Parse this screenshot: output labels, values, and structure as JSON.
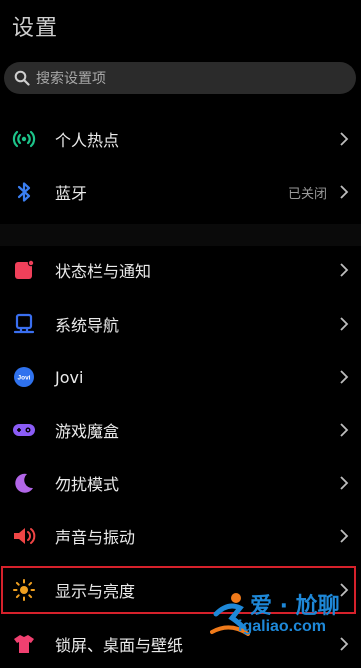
{
  "header": {
    "title": "设置"
  },
  "search": {
    "placeholder": "搜索设置项"
  },
  "items": [
    {
      "label": "个人热点",
      "status": "",
      "icon": "hotspot-icon",
      "color": "#1dc48a"
    },
    {
      "label": "蓝牙",
      "status": "已关闭",
      "icon": "bluetooth-icon",
      "color": "#3a7ef0"
    },
    {
      "label": "状态栏与通知",
      "status": "",
      "icon": "notification-icon",
      "color": "#f0405a"
    },
    {
      "label": "系统导航",
      "status": "",
      "icon": "navigation-icon",
      "color": "#3a6ff0"
    },
    {
      "label": "Jovi",
      "status": "",
      "icon": "jovi-icon",
      "color": "#2f72ee"
    },
    {
      "label": "游戏魔盒",
      "status": "",
      "icon": "gamepad-icon",
      "color": "#8b5cf6"
    },
    {
      "label": "勿扰模式",
      "status": "",
      "icon": "moon-icon",
      "color": "#b266e8"
    },
    {
      "label": "声音与振动",
      "status": "",
      "icon": "speaker-icon",
      "color": "#f04545"
    },
    {
      "label": "显示与亮度",
      "status": "",
      "icon": "sun-icon",
      "color": "#f0a020"
    },
    {
      "label": "锁屏、桌面与壁纸",
      "status": "",
      "icon": "shirt-icon",
      "color": "#f04070"
    }
  ],
  "watermark": {
    "title": "爱 · 尬聊",
    "url": "igaliao.com"
  },
  "colors": {
    "background": "#000000",
    "highlight": "#d6212b",
    "watermark": "#1e88d8"
  }
}
